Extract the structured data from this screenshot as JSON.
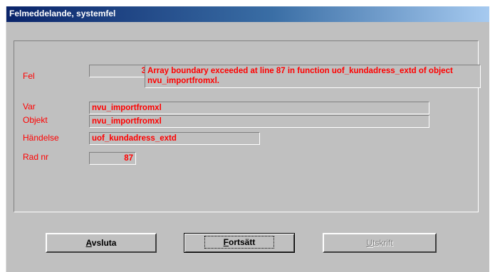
{
  "window": {
    "title": "Felmeddelande, systemfel"
  },
  "fields": {
    "fel": {
      "label": "Fel",
      "code": "3",
      "message": "Array boundary exceeded at line 87 in function uof_kundadress_extd of object nvu_importfromxl."
    },
    "var": {
      "label": "Var",
      "value": "nvu_importfromxl"
    },
    "objekt": {
      "label": "Objekt",
      "value": "nvu_importfromxl"
    },
    "handelse": {
      "label": "Händelse",
      "value": "uof_kundadress_extd"
    },
    "rad_nr": {
      "label": "Rad nr",
      "value": "87"
    }
  },
  "buttons": {
    "avsluta": {
      "accel": "A",
      "rest": "vsluta"
    },
    "fortsatt": {
      "accel": "F",
      "rest": "ortsätt"
    },
    "utskrift": {
      "accel": "U",
      "rest": "tskrift"
    }
  },
  "colors": {
    "title_gradient_start": "#0a246a",
    "title_gradient_end": "#a6caf0",
    "error_text": "#ff0000",
    "dialog_face": "#c0c0c0"
  }
}
